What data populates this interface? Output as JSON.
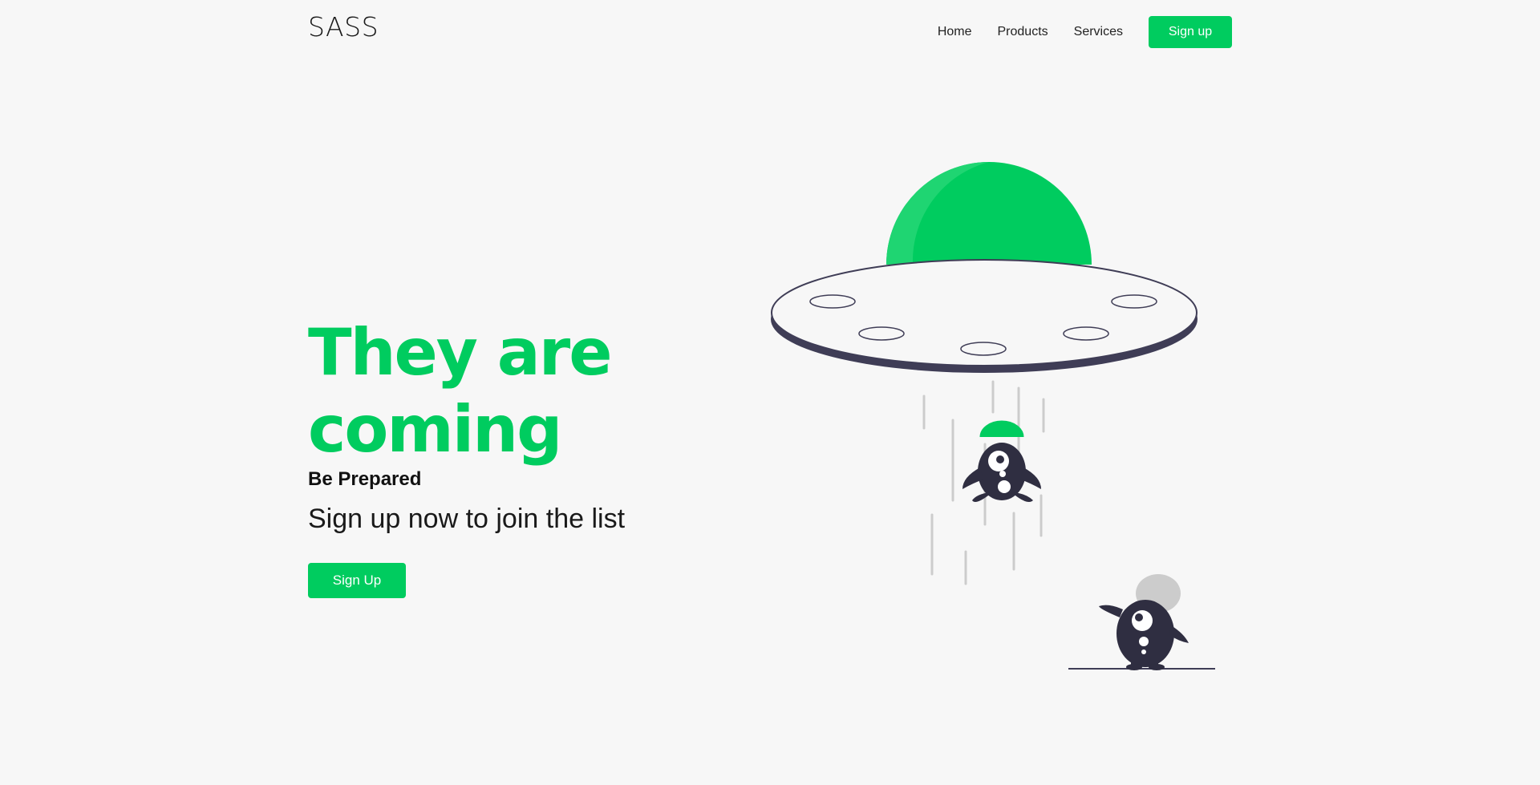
{
  "header": {
    "logo": "SASS",
    "nav": [
      "Home",
      "Products",
      "Services"
    ],
    "signup_label": "Sign up"
  },
  "hero": {
    "title": "They are coming",
    "kicker": "Be Prepared",
    "subtitle": "Sign up now to join the list",
    "cta_label": "Sign Up"
  },
  "illustration": {
    "icon": "ufo-abduction-illustration",
    "colors": {
      "accent": "#00cc5f",
      "dark": "#2f2e41",
      "beam": "#cccccc"
    }
  },
  "colors": {
    "accent": "#00cc5f",
    "background": "#f7f7f7",
    "text": "#1a1a1a"
  }
}
